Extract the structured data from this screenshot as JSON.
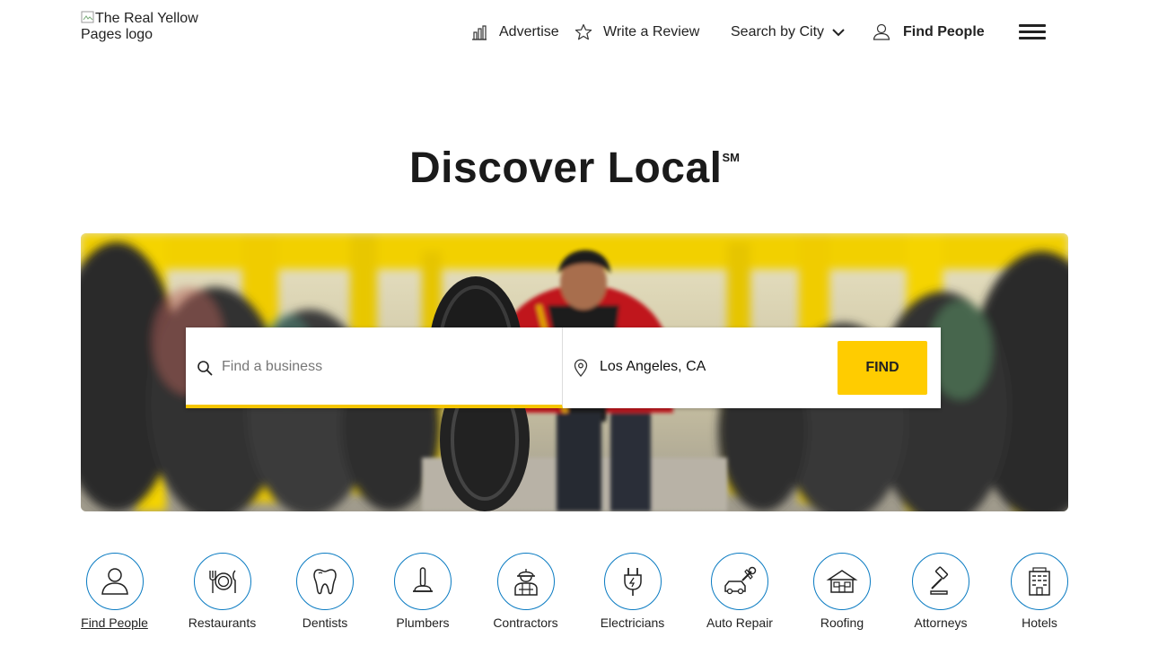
{
  "header": {
    "logo_alt": "The Real Yellow Pages logo",
    "nav": {
      "advertise": "Advertise",
      "write_review": "Write a Review",
      "search_by_city": "Search by City",
      "find_people": "Find People"
    }
  },
  "headline": {
    "text": "Discover Local",
    "mark": "SM"
  },
  "search": {
    "what_placeholder": "Find a business",
    "what_value": "",
    "where_value": "Los Angeles, CA",
    "find_label": "FIND"
  },
  "categories": [
    {
      "label": "Find People",
      "icon": "person-icon",
      "active": true
    },
    {
      "label": "Restaurants",
      "icon": "plate-utensils-icon"
    },
    {
      "label": "Dentists",
      "icon": "tooth-icon"
    },
    {
      "label": "Plumbers",
      "icon": "plunger-icon"
    },
    {
      "label": "Contractors",
      "icon": "worker-hardhat-icon"
    },
    {
      "label": "Electricians",
      "icon": "plug-icon"
    },
    {
      "label": "Auto Repair",
      "icon": "car-wrench-icon"
    },
    {
      "label": "Roofing",
      "icon": "house-icon"
    },
    {
      "label": "Attorneys",
      "icon": "gavel-icon"
    },
    {
      "label": "Hotels",
      "icon": "hotel-building-icon"
    }
  ],
  "colors": {
    "accent_yellow": "#ffcc00",
    "icon_circle_blue": "#0a7bc2"
  }
}
